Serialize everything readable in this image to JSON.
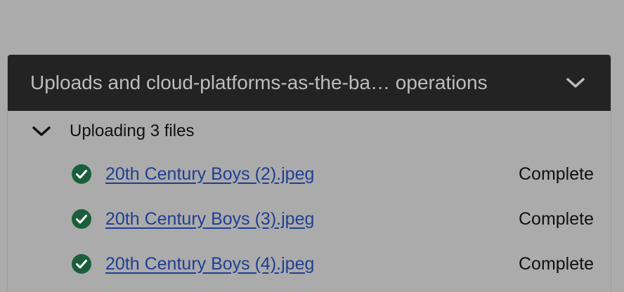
{
  "panel": {
    "title": "Uploads and cloud-platforms-as-the-ba… operations",
    "toggle_icon": "chevron-down-icon"
  },
  "group": {
    "label": "Uploading 3 files",
    "toggle_icon": "chevron-down-icon"
  },
  "files": [
    {
      "name": "20th Century Boys (2).jpeg",
      "status": "Complete",
      "icon": "check-circle-icon"
    },
    {
      "name": "20th Century Boys (3).jpeg",
      "status": "Complete",
      "icon": "check-circle-icon"
    },
    {
      "name": "20th Century Boys (4).jpeg",
      "status": "Complete",
      "icon": "check-circle-icon"
    }
  ],
  "colors": {
    "backdrop": "#ababab",
    "header_bg": "#232323",
    "header_text": "#bdbdbd",
    "success": "#1b5e3b",
    "link": "#1f3f92"
  }
}
